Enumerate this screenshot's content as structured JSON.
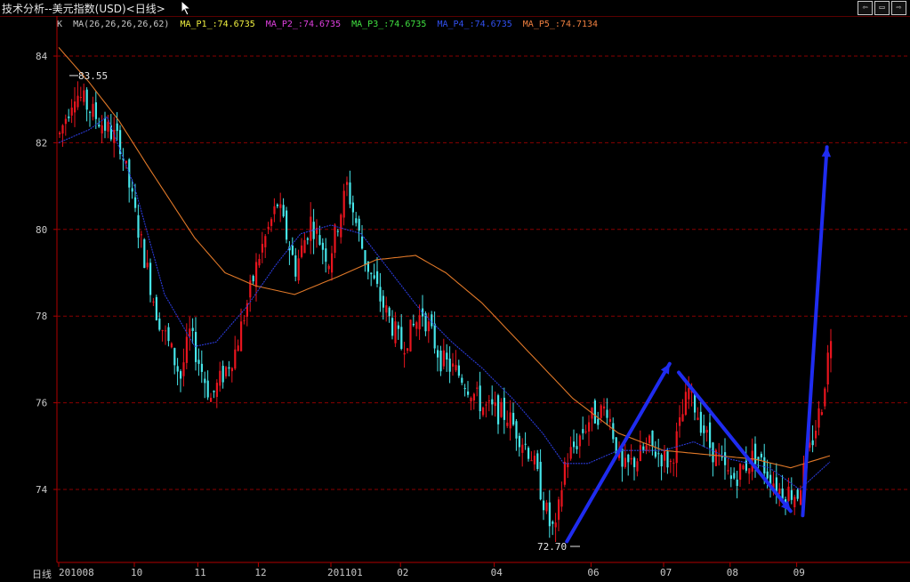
{
  "window": {
    "title": "技术分析--美元指数(USD)<日线>"
  },
  "buttons": {
    "prev": "⇦",
    "next": "⇨",
    "restore": "▭"
  },
  "legend": {
    "k": "K",
    "ma_params": "MA(26,26,26,26,62)",
    "p1": "MA_P1_:74.6735",
    "p2": "MA_P2_:74.6735",
    "p3": "MA_P3_:74.6735",
    "p4": "MA_P4_:74.6735",
    "p5": "MA_P5_:74.7134"
  },
  "colors": {
    "background": "#000000",
    "grid": "#8a0000",
    "up": "#e8141e",
    "down": "#46e6ea",
    "ma_short": "#2a3ad8",
    "ma_long": "#e07828",
    "arrow": "#1f2cf0",
    "p1": "#f0f040",
    "p2": "#e040e0",
    "p3": "#40e040",
    "p4": "#3050f0",
    "p5": "#f08040"
  },
  "x_axis_label": "日线",
  "annotations": {
    "high": "83.55",
    "low": "72.70"
  },
  "chart_data": {
    "type": "candlestick",
    "ylim": [
      72.5,
      84.8
    ],
    "y_ticks": [
      "84",
      "82",
      "80",
      "78",
      "76",
      "74"
    ],
    "y_tick_values": [
      84,
      82,
      80,
      78,
      76,
      74
    ],
    "x_tick_labels": [
      "201008",
      "10",
      "11",
      "12",
      "201101",
      "02",
      "04",
      "06",
      "07",
      "08",
      "09"
    ],
    "n_bars": 256,
    "x_tick_bar_index": [
      0,
      25,
      46,
      66,
      90,
      113,
      144,
      176,
      200,
      222,
      244
    ],
    "anchors": [
      {
        "i": 0,
        "v": 82.2
      },
      {
        "i": 5,
        "v": 83.2
      },
      {
        "i": 12,
        "v": 82.6
      },
      {
        "i": 20,
        "v": 82.0
      },
      {
        "i": 26,
        "v": 80.0
      },
      {
        "i": 32,
        "v": 78.1
      },
      {
        "i": 40,
        "v": 76.6
      },
      {
        "i": 43,
        "v": 77.6
      },
      {
        "i": 50,
        "v": 76.1
      },
      {
        "i": 58,
        "v": 77.2
      },
      {
        "i": 66,
        "v": 79.4
      },
      {
        "i": 72,
        "v": 80.6
      },
      {
        "i": 78,
        "v": 79.1
      },
      {
        "i": 83,
        "v": 80.2
      },
      {
        "i": 89,
        "v": 79.3
      },
      {
        "i": 95,
        "v": 81.0
      },
      {
        "i": 101,
        "v": 79.3
      },
      {
        "i": 106,
        "v": 78.4
      },
      {
        "i": 113,
        "v": 77.3
      },
      {
        "i": 120,
        "v": 78.1
      },
      {
        "i": 126,
        "v": 77.0
      },
      {
        "i": 133,
        "v": 76.6
      },
      {
        "i": 140,
        "v": 75.9
      },
      {
        "i": 148,
        "v": 75.7
      },
      {
        "i": 156,
        "v": 74.8
      },
      {
        "i": 162,
        "v": 73.2
      },
      {
        "i": 164,
        "v": 73.0
      },
      {
        "i": 167,
        "v": 74.6
      },
      {
        "i": 175,
        "v": 75.6
      },
      {
        "i": 181,
        "v": 75.9
      },
      {
        "i": 186,
        "v": 74.4
      },
      {
        "i": 195,
        "v": 75.0
      },
      {
        "i": 202,
        "v": 74.6
      },
      {
        "i": 208,
        "v": 76.3
      },
      {
        "i": 215,
        "v": 75.0
      },
      {
        "i": 222,
        "v": 74.2
      },
      {
        "i": 230,
        "v": 74.8
      },
      {
        "i": 238,
        "v": 74.0
      },
      {
        "i": 244,
        "v": 73.9
      },
      {
        "i": 248,
        "v": 74.9
      },
      {
        "i": 252,
        "v": 76.0
      },
      {
        "i": 255,
        "v": 77.6
      }
    ],
    "ma_short": [
      {
        "i": 0,
        "v": 82.0
      },
      {
        "i": 10,
        "v": 82.3
      },
      {
        "i": 16,
        "v": 82.6
      },
      {
        "i": 25,
        "v": 81.0
      },
      {
        "i": 35,
        "v": 78.5
      },
      {
        "i": 45,
        "v": 77.3
      },
      {
        "i": 52,
        "v": 77.4
      },
      {
        "i": 62,
        "v": 78.2
      },
      {
        "i": 72,
        "v": 79.2
      },
      {
        "i": 80,
        "v": 79.9
      },
      {
        "i": 90,
        "v": 80.1
      },
      {
        "i": 100,
        "v": 79.9
      },
      {
        "i": 110,
        "v": 79.0
      },
      {
        "i": 120,
        "v": 78.1
      },
      {
        "i": 130,
        "v": 77.4
      },
      {
        "i": 140,
        "v": 76.8
      },
      {
        "i": 150,
        "v": 76.1
      },
      {
        "i": 160,
        "v": 75.3
      },
      {
        "i": 167,
        "v": 74.6
      },
      {
        "i": 175,
        "v": 74.6
      },
      {
        "i": 185,
        "v": 74.9
      },
      {
        "i": 200,
        "v": 74.9
      },
      {
        "i": 210,
        "v": 75.1
      },
      {
        "i": 222,
        "v": 74.7
      },
      {
        "i": 235,
        "v": 74.5
      },
      {
        "i": 245,
        "v": 74.0
      },
      {
        "i": 256,
        "v": 74.7
      }
    ],
    "ma_long": [
      {
        "i": 0,
        "v": 84.2
      },
      {
        "i": 10,
        "v": 83.4
      },
      {
        "i": 20,
        "v": 82.5
      },
      {
        "i": 30,
        "v": 81.4
      },
      {
        "i": 45,
        "v": 79.8
      },
      {
        "i": 55,
        "v": 79.0
      },
      {
        "i": 65,
        "v": 78.7
      },
      {
        "i": 78,
        "v": 78.5
      },
      {
        "i": 92,
        "v": 78.9
      },
      {
        "i": 105,
        "v": 79.3
      },
      {
        "i": 118,
        "v": 79.4
      },
      {
        "i": 128,
        "v": 79.0
      },
      {
        "i": 140,
        "v": 78.3
      },
      {
        "i": 155,
        "v": 77.2
      },
      {
        "i": 170,
        "v": 76.1
      },
      {
        "i": 185,
        "v": 75.3
      },
      {
        "i": 200,
        "v": 74.9
      },
      {
        "i": 215,
        "v": 74.8
      },
      {
        "i": 230,
        "v": 74.7
      },
      {
        "i": 242,
        "v": 74.5
      },
      {
        "i": 256,
        "v": 74.8
      }
    ],
    "trend_arrows": [
      {
        "from": {
          "i": 168,
          "v": 72.8
        },
        "to": {
          "i": 202,
          "v": 76.9
        }
      },
      {
        "from": {
          "i": 205,
          "v": 76.7
        },
        "to": {
          "i": 242,
          "v": 73.5
        }
      },
      {
        "from": {
          "i": 246,
          "v": 73.4
        },
        "to": {
          "i": 254,
          "v": 81.9
        }
      }
    ],
    "high_label_value": 83.55,
    "low_label_value": 72.7
  }
}
